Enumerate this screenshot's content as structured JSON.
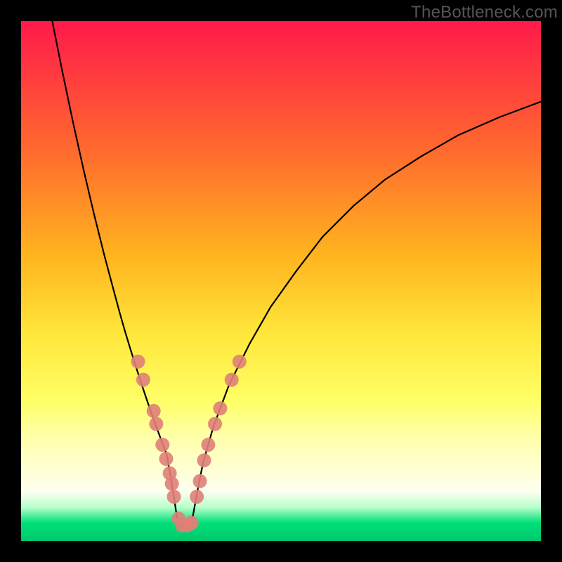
{
  "watermark": {
    "text": "TheBottleneck.com"
  },
  "chart_data": {
    "type": "line",
    "title": "",
    "xlabel": "",
    "ylabel": "",
    "xlim": [
      0,
      100
    ],
    "ylim": [
      0,
      100
    ],
    "grid": false,
    "legend": null,
    "background_gradient": {
      "stops": [
        {
          "offset": 0.0,
          "color": "#ff1a4b"
        },
        {
          "offset": 0.1,
          "color": "#ff3a3f"
        },
        {
          "offset": 0.25,
          "color": "#ff6a2e"
        },
        {
          "offset": 0.45,
          "color": "#ffb41f"
        },
        {
          "offset": 0.6,
          "color": "#ffe63a"
        },
        {
          "offset": 0.73,
          "color": "#ffff66"
        },
        {
          "offset": 0.8,
          "color": "#ffffaa"
        },
        {
          "offset": 0.86,
          "color": "#ffffd2"
        },
        {
          "offset": 0.905,
          "color": "#fdfff0"
        },
        {
          "offset": 0.935,
          "color": "#b8ffcc"
        },
        {
          "offset": 0.965,
          "color": "#00e07a"
        },
        {
          "offset": 1.0,
          "color": "#00c86a"
        }
      ]
    },
    "series": [
      {
        "name": "left-curve",
        "color": "#000000",
        "x": [
          6,
          8,
          10,
          12,
          14,
          16,
          18,
          19,
          20,
          21,
          22,
          23,
          24,
          25,
          26,
          27,
          28,
          29,
          30
        ],
        "y": [
          100,
          90,
          80.5,
          71.5,
          63,
          55,
          47.5,
          43.8,
          40.3,
          37,
          33.8,
          30.7,
          27.7,
          24.8,
          22,
          19.3,
          16.7,
          11,
          4.5
        ]
      },
      {
        "name": "valley-floor",
        "color": "#000000",
        "x": [
          30,
          31,
          32,
          33
        ],
        "y": [
          3.2,
          2.8,
          2.8,
          3.2
        ]
      },
      {
        "name": "right-curve",
        "color": "#000000",
        "x": [
          33,
          34,
          35,
          37,
          40,
          44,
          48,
          53,
          58,
          64,
          70,
          77,
          84,
          92,
          100
        ],
        "y": [
          4.5,
          10,
          15,
          22,
          30,
          38,
          45,
          52,
          58.5,
          64.5,
          69.5,
          74,
          78,
          81.5,
          84.5
        ]
      }
    ],
    "points": {
      "name": "marker-dots",
      "color": "#e08078",
      "radius": 10,
      "xy": [
        [
          22.5,
          34.5
        ],
        [
          23.5,
          31
        ],
        [
          25.5,
          25
        ],
        [
          26.0,
          22.5
        ],
        [
          27.2,
          18.5
        ],
        [
          27.9,
          15.8
        ],
        [
          28.6,
          13
        ],
        [
          29.0,
          11
        ],
        [
          29.4,
          8.5
        ],
        [
          30.3,
          4.3
        ],
        [
          31.0,
          3.0
        ],
        [
          32.0,
          3.0
        ],
        [
          32.8,
          3.5
        ],
        [
          33.8,
          8.5
        ],
        [
          34.4,
          11.5
        ],
        [
          35.2,
          15.5
        ],
        [
          36.0,
          18.5
        ],
        [
          37.3,
          22.5
        ],
        [
          38.3,
          25.5
        ],
        [
          40.5,
          31
        ],
        [
          42.0,
          34.5
        ]
      ]
    }
  }
}
